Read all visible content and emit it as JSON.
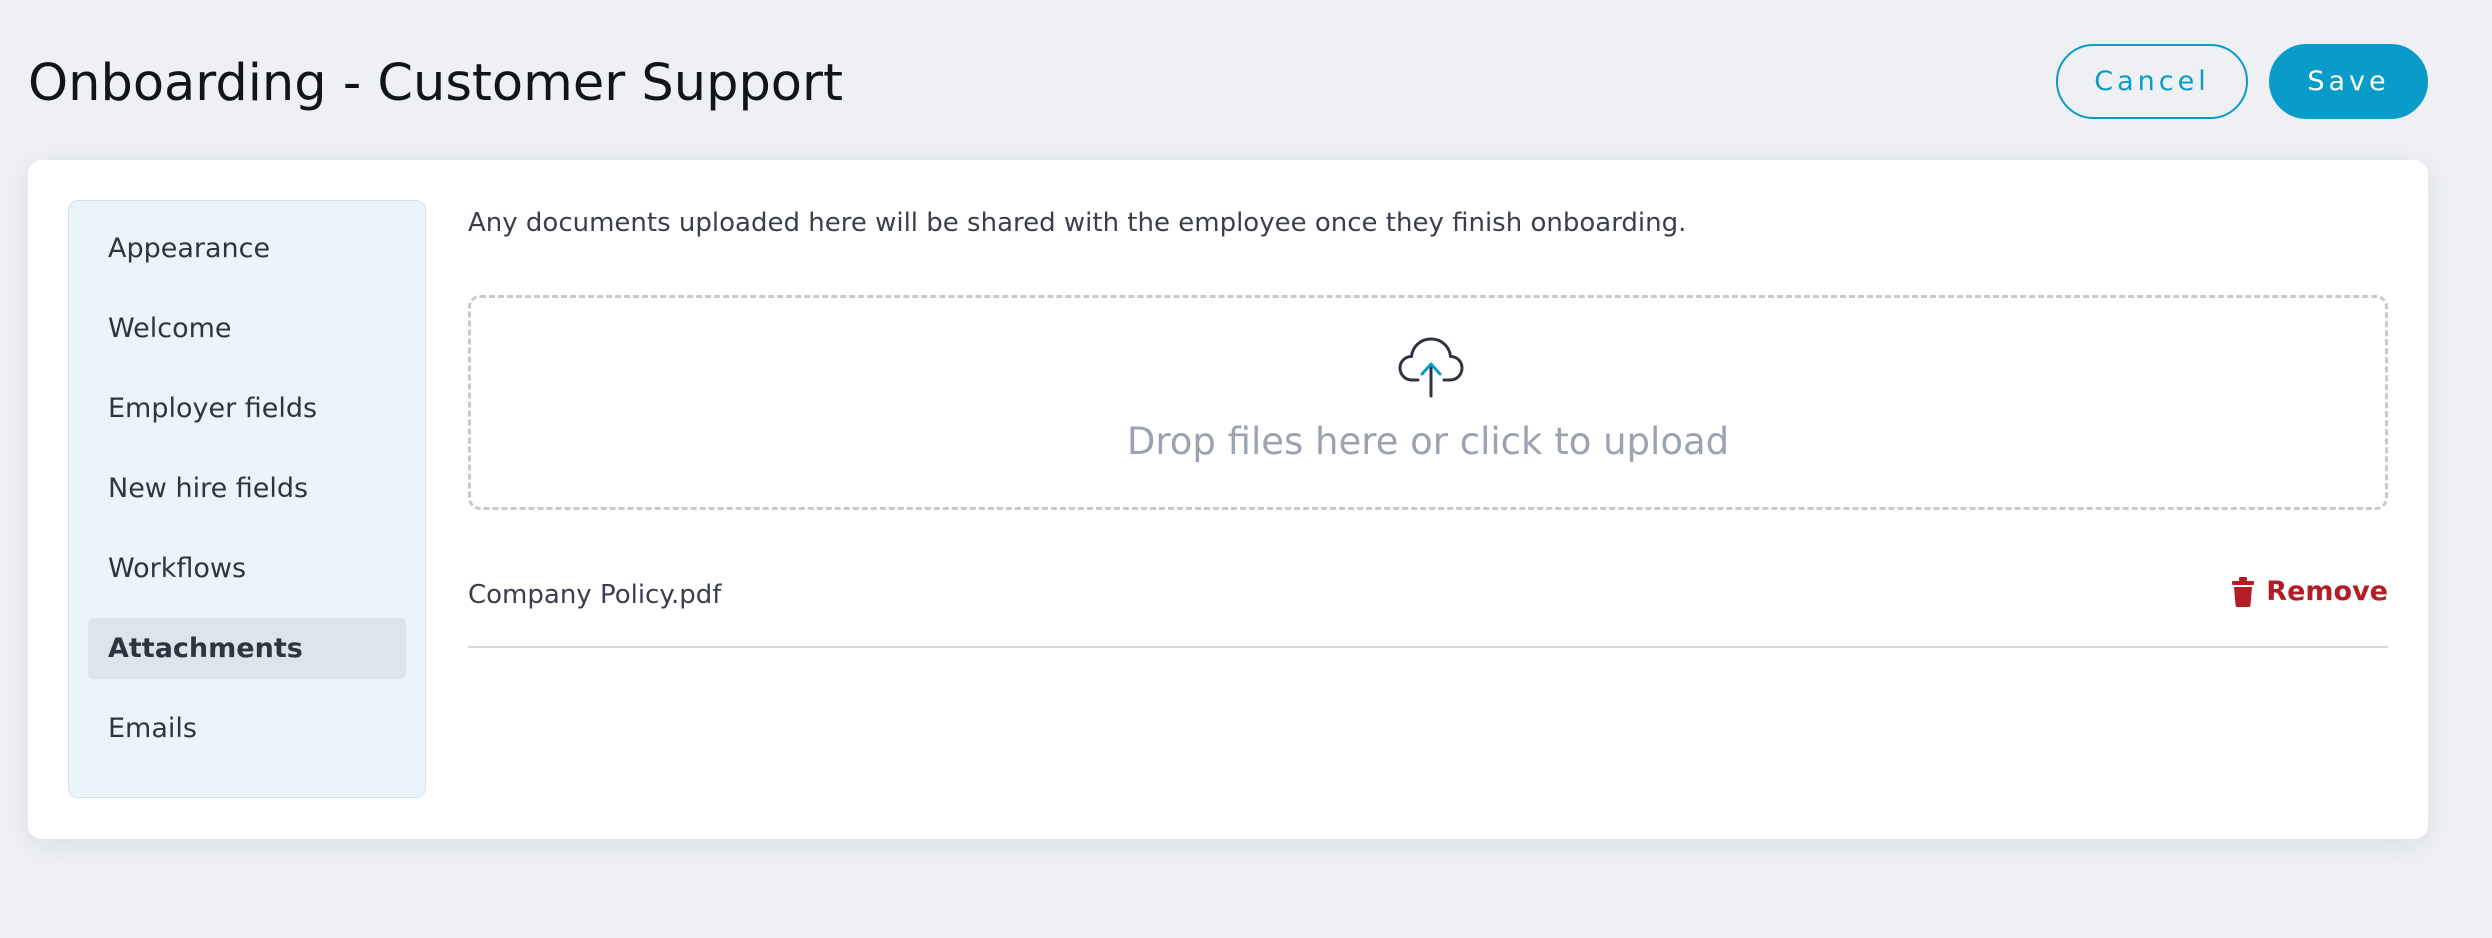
{
  "header": {
    "title": "Onboarding - Customer Support",
    "cancel_label": "Cancel",
    "save_label": "Save"
  },
  "sidebar": {
    "items": [
      {
        "label": "Appearance",
        "active": false
      },
      {
        "label": "Welcome",
        "active": false
      },
      {
        "label": "Employer fields",
        "active": false
      },
      {
        "label": "New hire fields",
        "active": false
      },
      {
        "label": "Workflows",
        "active": false
      },
      {
        "label": "Attachments",
        "active": true
      },
      {
        "label": "Emails",
        "active": false
      }
    ]
  },
  "main": {
    "intro_text": "Any documents uploaded here will be shared with the employee once they finish onboarding.",
    "dropzone": {
      "icon": "cloud-upload-icon",
      "text": "Drop files here or click to upload"
    },
    "files": [
      {
        "name": "Company Policy.pdf",
        "remove_label": "Remove",
        "remove_icon": "trash-icon"
      }
    ]
  },
  "colors": {
    "accent": "#0a9cc9",
    "danger": "#b31d26",
    "background": "#eef0f4",
    "sidebar_bg": "#eaf4f9"
  }
}
